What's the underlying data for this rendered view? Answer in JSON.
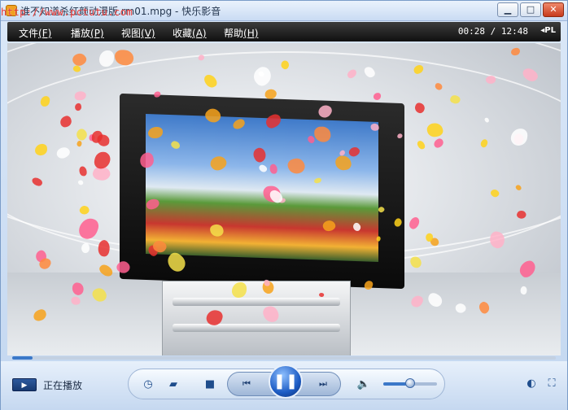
{
  "window": {
    "watermark": "http://www.pctutu.com",
    "title": "谁不知道杀红颜动漫版.rm01.mpg - 快乐影音",
    "buttons": {
      "minimize": "▁",
      "maximize": "□",
      "close": "✕"
    }
  },
  "menu": [
    {
      "label": "文件",
      "key": "(F)"
    },
    {
      "label": "播放",
      "key": "(P)"
    },
    {
      "label": "视图",
      "key": "(V)"
    },
    {
      "label": "收藏",
      "key": "(A)"
    },
    {
      "label": "帮助",
      "key": "(H)"
    }
  ],
  "playback": {
    "time": "00:28 / 12:48",
    "playlist_toggle": "◂PL",
    "progress_fraction": 0.037,
    "status_text": "正在播放",
    "volume_fraction": 0.5
  },
  "icons": {
    "status": "playing-indicator-icon",
    "history": "clock-icon",
    "open": "folder-icon",
    "stop": "stop-icon",
    "prev": "previous-icon",
    "play_pause": "pause-icon",
    "next": "next-icon",
    "volume": "speaker-icon",
    "theme": "contrast-icon",
    "fullscreen": "fullscreen-icon"
  },
  "colors": {
    "menubar": "#101010",
    "accent": "#1d5cc4",
    "titlebar": "#c9dbf3"
  }
}
